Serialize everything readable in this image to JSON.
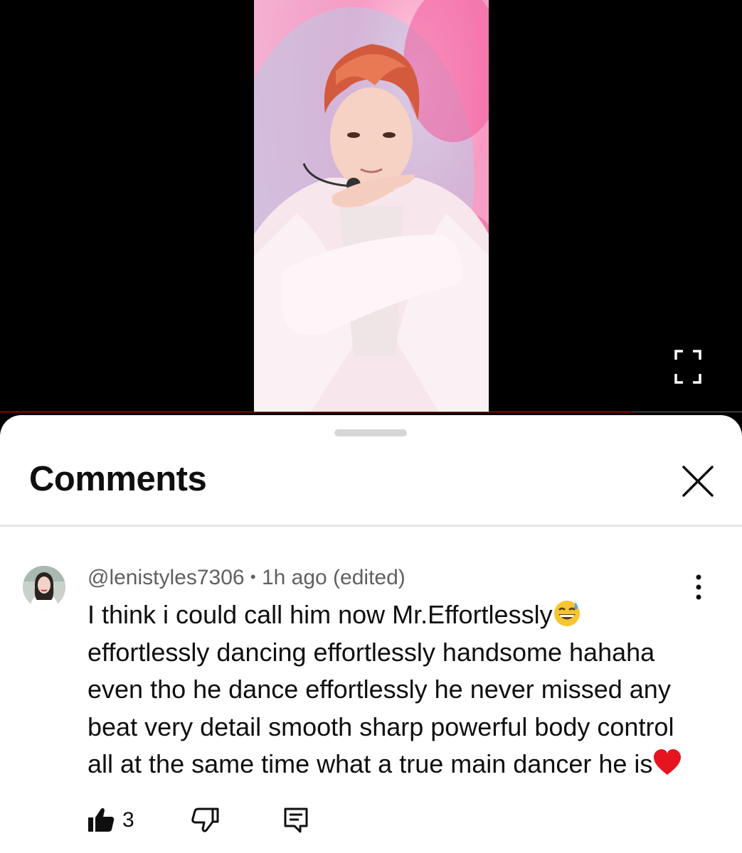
{
  "player": {
    "progress_fraction": 0.852,
    "colors": {
      "progress": "#ff0000",
      "track": "#6b6b6b"
    }
  },
  "sheet": {
    "title": "Comments"
  },
  "comment": {
    "author": "@lenistyles7306",
    "separator": "•",
    "time": "1h ago (edited)",
    "lines": [
      "I think i could call him now Mr.Effortlessly",
      "effortlessly dancing effortlessly handsome hahaha",
      "even tho he dance effortlessly he never missed any",
      "beat very detail smooth sharp powerful body control",
      "all at the same time what a true main dancer he is"
    ],
    "like_count": "3"
  },
  "icons": {
    "fullscreen": "fullscreen-icon",
    "close": "close-icon",
    "more": "more-vert-icon",
    "like": "thumb-up-icon",
    "dislike": "thumb-down-icon",
    "reply": "reply-icon"
  }
}
